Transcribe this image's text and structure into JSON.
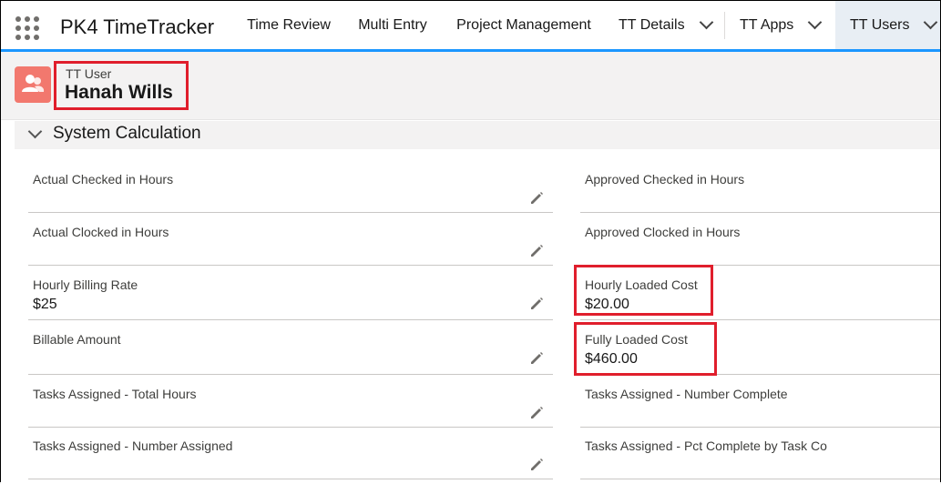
{
  "app": {
    "name": "PK4 TimeTracker"
  },
  "nav": {
    "items": [
      {
        "label": "Time Review"
      },
      {
        "label": "Multi Entry"
      },
      {
        "label": "Project Management"
      },
      {
        "label": "TT Details"
      },
      {
        "label": "TT Apps"
      },
      {
        "label": "TT Users"
      }
    ]
  },
  "record": {
    "object_label": "TT User",
    "name": "Hanah Wills"
  },
  "section": {
    "title": "System Calculation"
  },
  "fields": [
    {
      "label": "Actual Checked in Hours",
      "value": ""
    },
    {
      "label": "Approved Checked in Hours",
      "value": ""
    },
    {
      "label": "Actual Clocked in Hours",
      "value": ""
    },
    {
      "label": "Approved Clocked in Hours",
      "value": ""
    },
    {
      "label": "Hourly Billing Rate",
      "value": "$25"
    },
    {
      "label": "Hourly Loaded Cost",
      "value": "$20.00"
    },
    {
      "label": "Billable Amount",
      "value": ""
    },
    {
      "label": "Fully Loaded Cost",
      "value": "$460.00"
    },
    {
      "label": "Tasks Assigned - Total Hours",
      "value": ""
    },
    {
      "label": "Tasks Assigned - Number Complete",
      "value": ""
    },
    {
      "label": "Tasks Assigned - Number Assigned",
      "value": ""
    },
    {
      "label": "Tasks Assigned - Pct Complete by Task Co",
      "value": ""
    }
  ],
  "colors": {
    "accent": "#1b96ff",
    "highlight": "#e01e2c",
    "user_icon": "#f2786e"
  },
  "icons": {
    "app_launcher": "waffle-icon",
    "record": "user-group-icon",
    "edit": "pencil-icon"
  }
}
